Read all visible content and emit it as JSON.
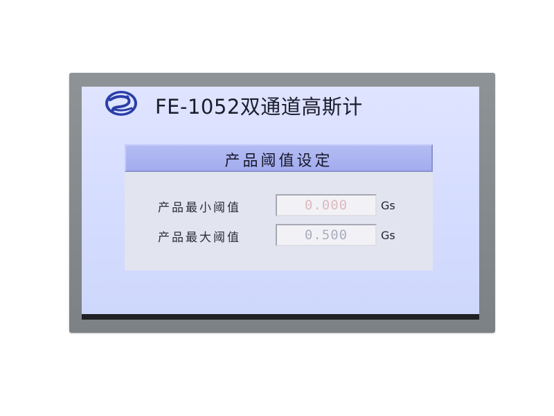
{
  "header": {
    "title": "FE-1052双通道高斯计",
    "logo_icon": "company-logo"
  },
  "panel": {
    "title": "产品阈值设定",
    "fields": [
      {
        "label": "产品最小阈值",
        "value": "0.000",
        "unit": "Gs"
      },
      {
        "label": "产品最大阈值",
        "value": "0.500",
        "unit": "Gs"
      }
    ]
  },
  "colors": {
    "screen_background": "#d8dfff",
    "panel_header": "#a8b0f0",
    "min_value_text": "#dcb9bf",
    "max_value_text": "#a9adc0",
    "device_frame": "#858a8e"
  }
}
